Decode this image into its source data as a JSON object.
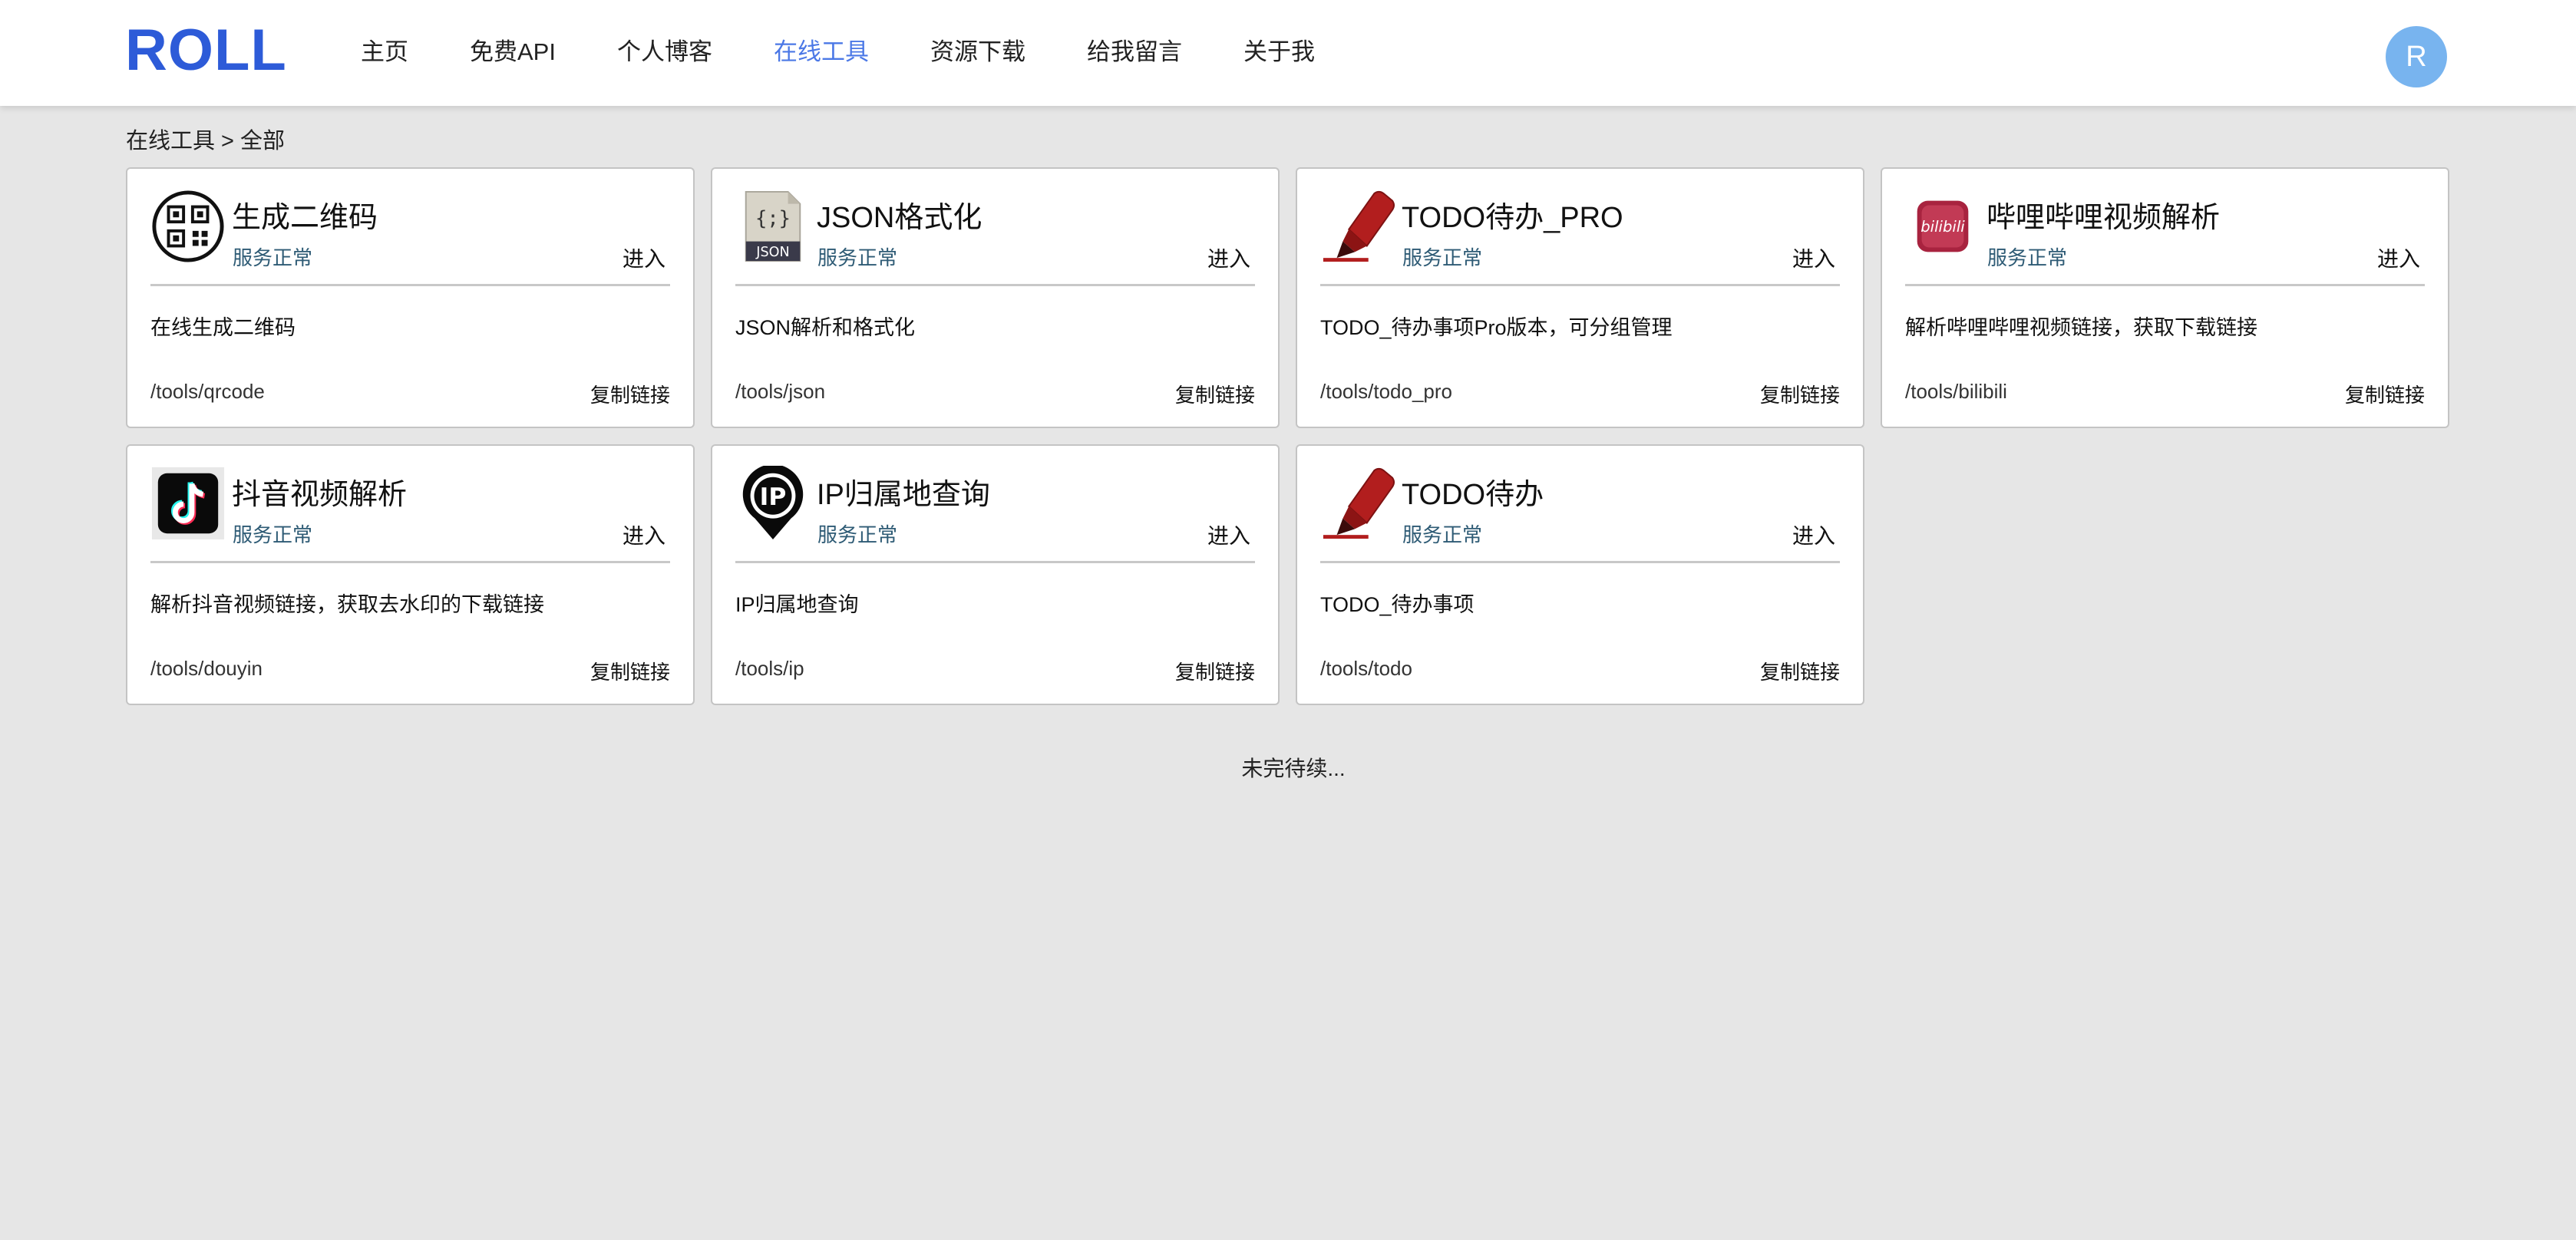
{
  "header": {
    "logo": "ROLL",
    "nav": [
      "主页",
      "免费API",
      "个人博客",
      "在线工具",
      "资源下载",
      "给我留言",
      "关于我"
    ],
    "active_nav": "在线工具",
    "avatar_letter": "R"
  },
  "breadcrumb": "在线工具 > 全部",
  "cards": [
    {
      "title": "生成二维码",
      "status": "服务正常",
      "enter": "进入",
      "desc": "在线生成二维码",
      "path": "/tools/qrcode",
      "copy": "复制链接",
      "icon": "qrcode-icon"
    },
    {
      "title": "JSON格式化",
      "status": "服务正常",
      "enter": "进入",
      "desc": "JSON解析和格式化",
      "path": "/tools/json",
      "copy": "复制链接",
      "icon": "json-file-icon"
    },
    {
      "title": "TODO待办_PRO",
      "status": "服务正常",
      "enter": "进入",
      "desc": "TODO_待办事项Pro版本，可分组管理",
      "path": "/tools/todo_pro",
      "copy": "复制链接",
      "icon": "marker-icon"
    },
    {
      "title": "哔哩哔哩视频解析",
      "status": "服务正常",
      "enter": "进入",
      "desc": "解析哔哩哔哩视频链接，获取下载链接",
      "path": "/tools/bilibili",
      "copy": "复制链接",
      "icon": "bilibili-icon"
    },
    {
      "title": "抖音视频解析",
      "status": "服务正常",
      "enter": "进入",
      "desc": "解析抖音视频链接，获取去水印的下载链接",
      "path": "/tools/douyin",
      "copy": "复制链接",
      "icon": "tiktok-icon"
    },
    {
      "title": "IP归属地查询",
      "status": "服务正常",
      "enter": "进入",
      "desc": "IP归属地查询",
      "path": "/tools/ip",
      "copy": "复制链接",
      "icon": "ip-location-icon"
    },
    {
      "title": "TODO待办",
      "status": "服务正常",
      "enter": "进入",
      "desc": "TODO_待办事项",
      "path": "/tools/todo",
      "copy": "复制链接",
      "icon": "marker-icon"
    }
  ],
  "footer_note": "未完待续...",
  "colors": {
    "brand": "#2d5bd8",
    "nav_active": "#4b78e6",
    "avatar": "#78b4ef",
    "status": "#2e5b75",
    "background": "#e6e6e6"
  }
}
